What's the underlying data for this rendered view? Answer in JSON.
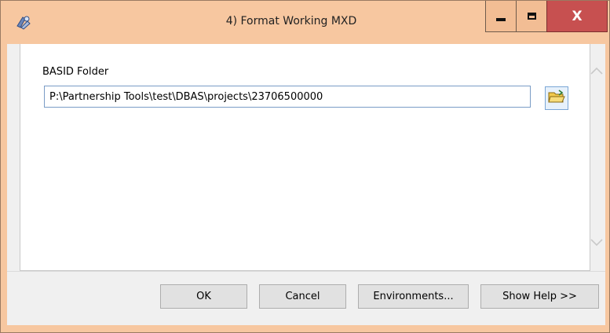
{
  "window": {
    "title": "4) Format Working MXD",
    "close_glyph": "X",
    "icons": {
      "app": "arcgis-tool-icon",
      "minimize": "minimize-icon",
      "maximize": "maximize-icon",
      "close": "close-icon"
    }
  },
  "form": {
    "basid_label": "BASID Folder",
    "basid_value": "P:\\Partnership Tools\\test\\DBAS\\projects\\23706500000",
    "browse_icon": "open-folder-icon"
  },
  "scroll": {
    "up_icon": "chevron-up-icon",
    "down_icon": "chevron-down-icon"
  },
  "buttons": {
    "ok": "OK",
    "cancel": "Cancel",
    "environments": "Environments...",
    "show_help": "Show Help >>"
  },
  "colors": {
    "title_bar": "#f7c7a0",
    "close_button": "#c75050",
    "input_border": "#7a9cc6"
  }
}
